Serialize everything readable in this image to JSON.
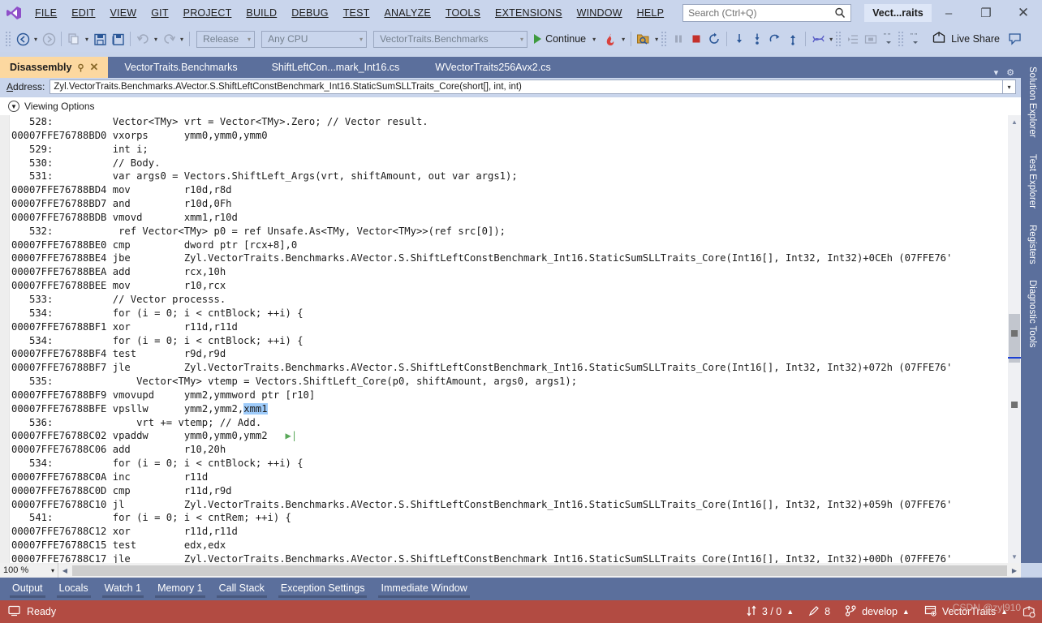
{
  "window": {
    "title_chip": "Vect...raits",
    "minimize": "–",
    "restore": "❐",
    "close": "✕"
  },
  "menubar": {
    "items": [
      "FILE",
      "EDIT",
      "VIEW",
      "GIT",
      "PROJECT",
      "BUILD",
      "DEBUG",
      "TEST",
      "ANALYZE",
      "TOOLS",
      "EXTENSIONS",
      "WINDOW",
      "HELP"
    ]
  },
  "search": {
    "placeholder": "Search (Ctrl+Q)",
    "icon": "search-icon"
  },
  "toolbar": {
    "back_icon": "navigate-back-icon",
    "forward_icon": "navigate-forward-icon",
    "new_item_icon": "new-item-icon",
    "save_icon": "save-icon",
    "save_all_icon": "save-all-icon",
    "undo_icon": "undo-icon",
    "redo_icon": "redo-icon",
    "configuration": "Release",
    "platform": "Any CPU",
    "startup_project": "VectorTraits.Benchmarks",
    "continue_label": "Continue",
    "hot_reload_icon": "hot-reload-icon",
    "attach_icon": "attach-to-process-icon",
    "break_icon": "break-all-icon",
    "stop_icon": "stop-debugging-icon",
    "restart_icon": "restart-icon",
    "step_into_icon": "step-into-icon",
    "step_over_icon": "step-over-icon",
    "step_out_icon": "step-out-icon",
    "thread_icon": "threads-icon",
    "live_share_label": "Live Share",
    "live_share_icon": "live-share-icon",
    "notify_icon": "feedback-icon"
  },
  "tabs": [
    {
      "label": "Disassembly",
      "active": true,
      "pinned": true,
      "closable": true
    },
    {
      "label": "VectorTraits.Benchmarks",
      "active": false
    },
    {
      "label": "ShiftLeftCon...mark_Int16.cs",
      "active": false
    },
    {
      "label": "WVectorTraits256Avx2.cs",
      "active": false
    }
  ],
  "address": {
    "label": "Address:",
    "value": "Zyl.VectorTraits.Benchmarks.AVector.S.ShiftLeftConstBenchmark_Int16.StaticSumSLLTraits_Core(short[], int, int)"
  },
  "viewing_options": {
    "label": "Viewing Options",
    "chevron": "chevron-down-icon"
  },
  "disassembly": {
    "lines": [
      {
        "type": "source",
        "num": "528:",
        "text": "        Vector<TMy> vrt = Vector<TMy>.Zero; // Vector result."
      },
      {
        "type": "asm",
        "addr": "00007FFE76788BD0",
        "mnemonic": "vxorps",
        "operands": "ymm0,ymm0,ymm0"
      },
      {
        "type": "source",
        "num": "529:",
        "text": "        int i;"
      },
      {
        "type": "source",
        "num": "530:",
        "text": "        // Body."
      },
      {
        "type": "source",
        "num": "531:",
        "text": "        var args0 = Vectors.ShiftLeft_Args(vrt, shiftAmount, out var args1);"
      },
      {
        "type": "asm",
        "addr": "00007FFE76788BD4",
        "mnemonic": "mov",
        "operands": "r10d,r8d"
      },
      {
        "type": "asm",
        "addr": "00007FFE76788BD7",
        "mnemonic": "and",
        "operands": "r10d,0Fh"
      },
      {
        "type": "asm",
        "addr": "00007FFE76788BDB",
        "mnemonic": "vmovd",
        "operands": "xmm1,r10d",
        "soft_hl": "xmm1"
      },
      {
        "type": "source",
        "num": "532:",
        "text": "         ref Vector<TMy> p0 = ref Unsafe.As<TMy, Vector<TMy>>(ref src[0]);"
      },
      {
        "type": "asm",
        "addr": "00007FFE76788BE0",
        "mnemonic": "cmp",
        "operands": "dword ptr [rcx+8],0"
      },
      {
        "type": "asm",
        "addr": "00007FFE76788BE4",
        "mnemonic": "jbe",
        "operands": "Zyl.VectorTraits.Benchmarks.AVector.S.ShiftLeftConstBenchmark_Int16.StaticSumSLLTraits_Core(Int16[], Int32, Int32)+0CEh (07FFE76'"
      },
      {
        "type": "asm",
        "addr": "00007FFE76788BEA",
        "mnemonic": "add",
        "operands": "rcx,10h"
      },
      {
        "type": "asm",
        "addr": "00007FFE76788BEE",
        "mnemonic": "mov",
        "operands": "r10,rcx"
      },
      {
        "type": "source",
        "num": "533:",
        "text": "        // Vector processs."
      },
      {
        "type": "source",
        "num": "534:",
        "text": "        for (i = 0; i < cntBlock; ++i) {"
      },
      {
        "type": "asm",
        "addr": "00007FFE76788BF1",
        "mnemonic": "xor",
        "operands": "r11d,r11d"
      },
      {
        "type": "source",
        "num": "534:",
        "text": "        for (i = 0; i < cntBlock; ++i) {"
      },
      {
        "type": "asm",
        "addr": "00007FFE76788BF4",
        "mnemonic": "test",
        "operands": "r9d,r9d"
      },
      {
        "type": "asm",
        "addr": "00007FFE76788BF7",
        "mnemonic": "jle",
        "operands": "Zyl.VectorTraits.Benchmarks.AVector.S.ShiftLeftConstBenchmark_Int16.StaticSumSLLTraits_Core(Int16[], Int32, Int32)+072h (07FFE76'"
      },
      {
        "type": "source",
        "num": "535:",
        "text": "            Vector<TMy> vtemp = Vectors.ShiftLeft_Core(p0, shiftAmount, args0, args1);"
      },
      {
        "type": "asm",
        "addr": "00007FFE76788BF9",
        "mnemonic": "vmovupd",
        "operands": "ymm2,ymmword ptr [r10]"
      },
      {
        "type": "asm",
        "addr": "00007FFE76788BFE",
        "mnemonic": "vpsllw",
        "operands": "ymm2,ymm2,xmm1",
        "selected": "xmm1"
      },
      {
        "type": "source",
        "num": "536:",
        "text": "            vrt += vtemp; // Add."
      },
      {
        "type": "asm",
        "addr": "00007FFE76788C02",
        "mnemonic": "vpaddw",
        "operands": "ymm0,ymm0,ymm2",
        "step_marker": true
      },
      {
        "type": "asm",
        "addr": "00007FFE76788C06",
        "mnemonic": "add",
        "operands": "r10,20h"
      },
      {
        "type": "source",
        "num": "534:",
        "text": "        for (i = 0; i < cntBlock; ++i) {"
      },
      {
        "type": "asm",
        "addr": "00007FFE76788C0A",
        "mnemonic": "inc",
        "operands": "r11d"
      },
      {
        "type": "asm",
        "addr": "00007FFE76788C0D",
        "mnemonic": "cmp",
        "operands": "r11d,r9d"
      },
      {
        "type": "asm",
        "addr": "00007FFE76788C10",
        "mnemonic": "jl",
        "operands": "Zyl.VectorTraits.Benchmarks.AVector.S.ShiftLeftConstBenchmark_Int16.StaticSumSLLTraits_Core(Int16[], Int32, Int32)+059h (07FFE76'"
      },
      {
        "type": "source",
        "num": "541:",
        "text": "        for (i = 0; i < cntRem; ++i) {"
      },
      {
        "type": "asm",
        "addr": "00007FFE76788C12",
        "mnemonic": "xor",
        "operands": "r11d,r11d"
      },
      {
        "type": "asm",
        "addr": "00007FFE76788C15",
        "mnemonic": "test",
        "operands": "edx,edx"
      },
      {
        "type": "asm",
        "addr": "00007FFE76788C17",
        "mnemonic": "jle",
        "operands": "Zyl.VectorTraits.Benchmarks.AVector.S.ShiftLeftConstBenchmark_Int16.StaticSumSLLTraits_Core(Int16[], Int32, Int32)+00Dh (07FFE76'"
      }
    ]
  },
  "zoom": {
    "value": "100 %",
    "caret": "chevron-down-icon"
  },
  "rail_tabs": [
    "Solution Explorer",
    "Test Explorer",
    "Registers",
    "Diagnostic Tools"
  ],
  "bottom_tabs": [
    "Output",
    "Locals",
    "Watch 1",
    "Memory 1",
    "Call Stack",
    "Exception Settings",
    "Immediate Window"
  ],
  "statusbar": {
    "ready": "Ready",
    "ready_icon": "status-ready-icon",
    "source_control_counts": "3 / 0",
    "source_control_icon": "updown-arrows-icon",
    "pending_changes": "8",
    "pending_changes_icon": "pencil-icon",
    "branch": "develop",
    "branch_icon": "branch-icon",
    "repo": "VectorTraits",
    "repo_icon": "repository-icon",
    "caret_up": "▲"
  },
  "watermark": "CSDN @zyl910",
  "colors": {
    "chrome": "#c9d5ec",
    "tabstrip": "#5b6f9c",
    "active_tab": "#fcd8a0",
    "status": "#b24b42",
    "selection": "#9ecbfa",
    "accent": "#2b5797"
  }
}
